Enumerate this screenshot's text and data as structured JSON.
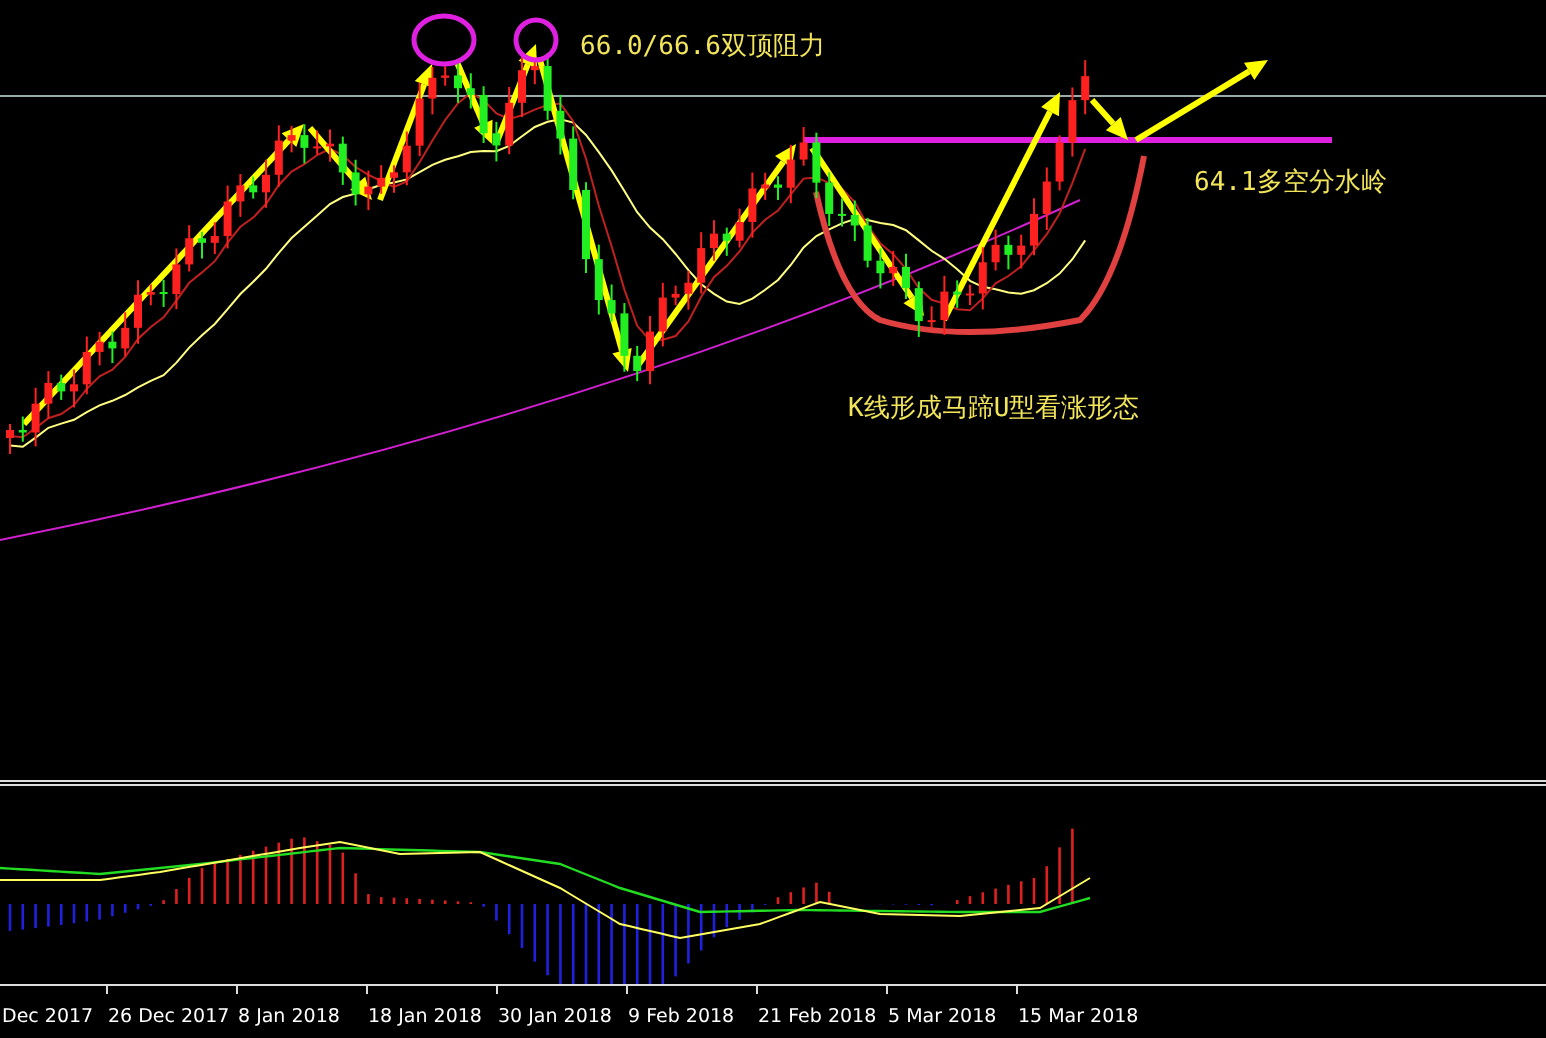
{
  "chart": {
    "annotations": [
      {
        "text": "66.0/66.6双顶阻力"
      },
      {
        "text": "64.1多空分水岭"
      },
      {
        "text": "K线形成马蹄U型看涨形态"
      }
    ]
  },
  "x_axis": {
    "labels": [
      "Dec 2017",
      "26 Dec 2017",
      "8 Jan 2018",
      "18 Jan 2018",
      "30 Jan 2018",
      "9 Feb 2018",
      "21 Feb 2018",
      "5 Mar 2018",
      "15 Mar 2018"
    ]
  }
}
